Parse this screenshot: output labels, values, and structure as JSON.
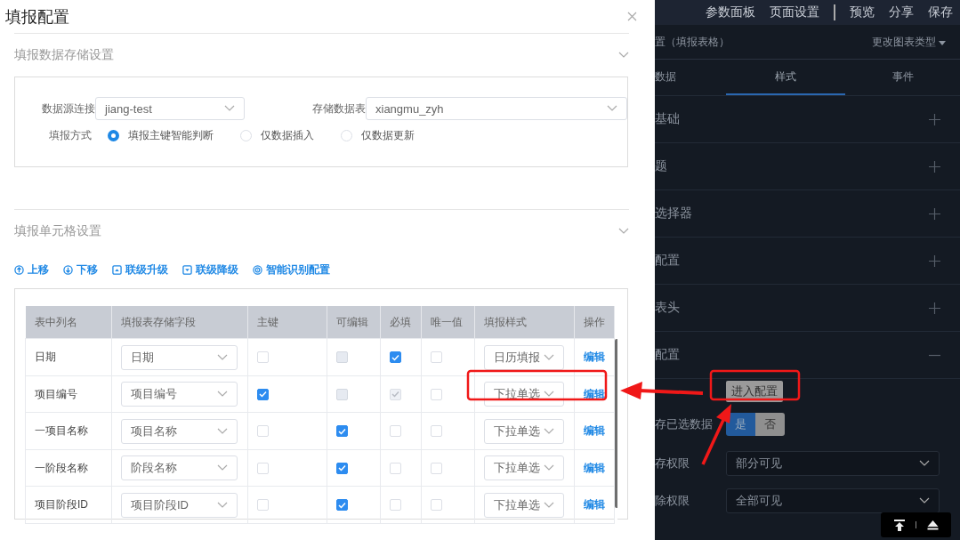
{
  "dialog": {
    "title": "填报配置",
    "storage_section": {
      "title": "填报数据存储设置",
      "fields": [
        {
          "label": "数据源连接",
          "value": "jiang-test"
        },
        {
          "label": "存储数据表",
          "value": "xiangmu_zyh"
        }
      ],
      "mode": {
        "label": "填报方式",
        "options": [
          {
            "label": "填报主键智能判断",
            "selected": true
          },
          {
            "label": "仅数据插入",
            "selected": false
          },
          {
            "label": "仅数据更新",
            "selected": false
          }
        ]
      }
    },
    "cell_section": {
      "title": "填报单元格设置",
      "toolbar": [
        {
          "label": "上移",
          "kind": "up"
        },
        {
          "label": "下移",
          "kind": "down"
        },
        {
          "label": "联级升级",
          "kind": "promote"
        },
        {
          "label": "联级降级",
          "kind": "demote"
        },
        {
          "label": "智能识别配置",
          "kind": "detect"
        }
      ],
      "table": {
        "columns": [
          "表中列名",
          "填报表存储字段",
          "主键",
          "可编辑",
          "必填",
          "唯一值",
          "填报样式",
          "操作"
        ],
        "rows": [
          {
            "column_name": "日期",
            "field": "日期",
            "checks": [
              {
                "checked": false,
                "disabled": false
              },
              {
                "checked": false,
                "disabled": true
              },
              {
                "checked": true,
                "disabled": false
              },
              {
                "checked": false,
                "disabled": false
              }
            ],
            "style": "日历填报",
            "action": "编辑"
          },
          {
            "column_name": "项目编号",
            "field": "项目编号",
            "checks": [
              {
                "checked": true,
                "disabled": false
              },
              {
                "checked": false,
                "disabled": true
              },
              {
                "checked": true,
                "disabled": true
              },
              {
                "checked": false,
                "disabled": false
              }
            ],
            "style": "下拉单选",
            "action": "编辑"
          },
          {
            "column_name": "一项目名称",
            "field": "项目名称",
            "checks": [
              {
                "checked": false,
                "disabled": false
              },
              {
                "checked": true,
                "disabled": false
              },
              {
                "checked": false,
                "disabled": false
              },
              {
                "checked": false,
                "disabled": false
              }
            ],
            "style": "下拉单选",
            "action": "编辑"
          },
          {
            "column_name": "一阶段名称",
            "field": "阶段名称",
            "checks": [
              {
                "checked": false,
                "disabled": false
              },
              {
                "checked": true,
                "disabled": false
              },
              {
                "checked": false,
                "disabled": false
              },
              {
                "checked": false,
                "disabled": false
              }
            ],
            "style": "下拉单选",
            "action": "编辑"
          },
          {
            "column_name": "项目阶段ID",
            "field": "项目阶段ID",
            "checks": [
              {
                "checked": false,
                "disabled": false
              },
              {
                "checked": true,
                "disabled": false
              },
              {
                "checked": false,
                "disabled": false
              },
              {
                "checked": false,
                "disabled": false
              }
            ],
            "style": "下拉单选",
            "action": "编辑"
          }
        ]
      }
    }
  },
  "panel": {
    "top_menu_left": [
      "参数面板",
      "页面设置"
    ],
    "top_menu_right": [
      "预览",
      "分享",
      "保存"
    ],
    "header": {
      "title": "置（填报表格）",
      "action": "更改图表类型"
    },
    "tabs": [
      {
        "label": "数据",
        "selected": false
      },
      {
        "label": "样式",
        "selected": true
      },
      {
        "label": "事件",
        "selected": false
      }
    ],
    "sections": [
      {
        "label": "基础",
        "expanded": false
      },
      {
        "label": "题",
        "expanded": false
      },
      {
        "label": "选择器",
        "expanded": false
      },
      {
        "label": "配置",
        "expanded": false
      },
      {
        "label": "表头",
        "expanded": false
      },
      {
        "label": "配置",
        "expanded": true
      }
    ],
    "form": [
      {
        "kind": "button",
        "button": "进入配置"
      },
      {
        "kind": "toggle",
        "label": "存已选数据",
        "options": [
          {
            "label": "是",
            "selected": true
          },
          {
            "label": "否",
            "selected": false
          }
        ]
      },
      {
        "kind": "select",
        "label": "存权限",
        "value": "部分可见"
      },
      {
        "kind": "select",
        "label": "除权限",
        "value": "全部可见"
      }
    ]
  }
}
